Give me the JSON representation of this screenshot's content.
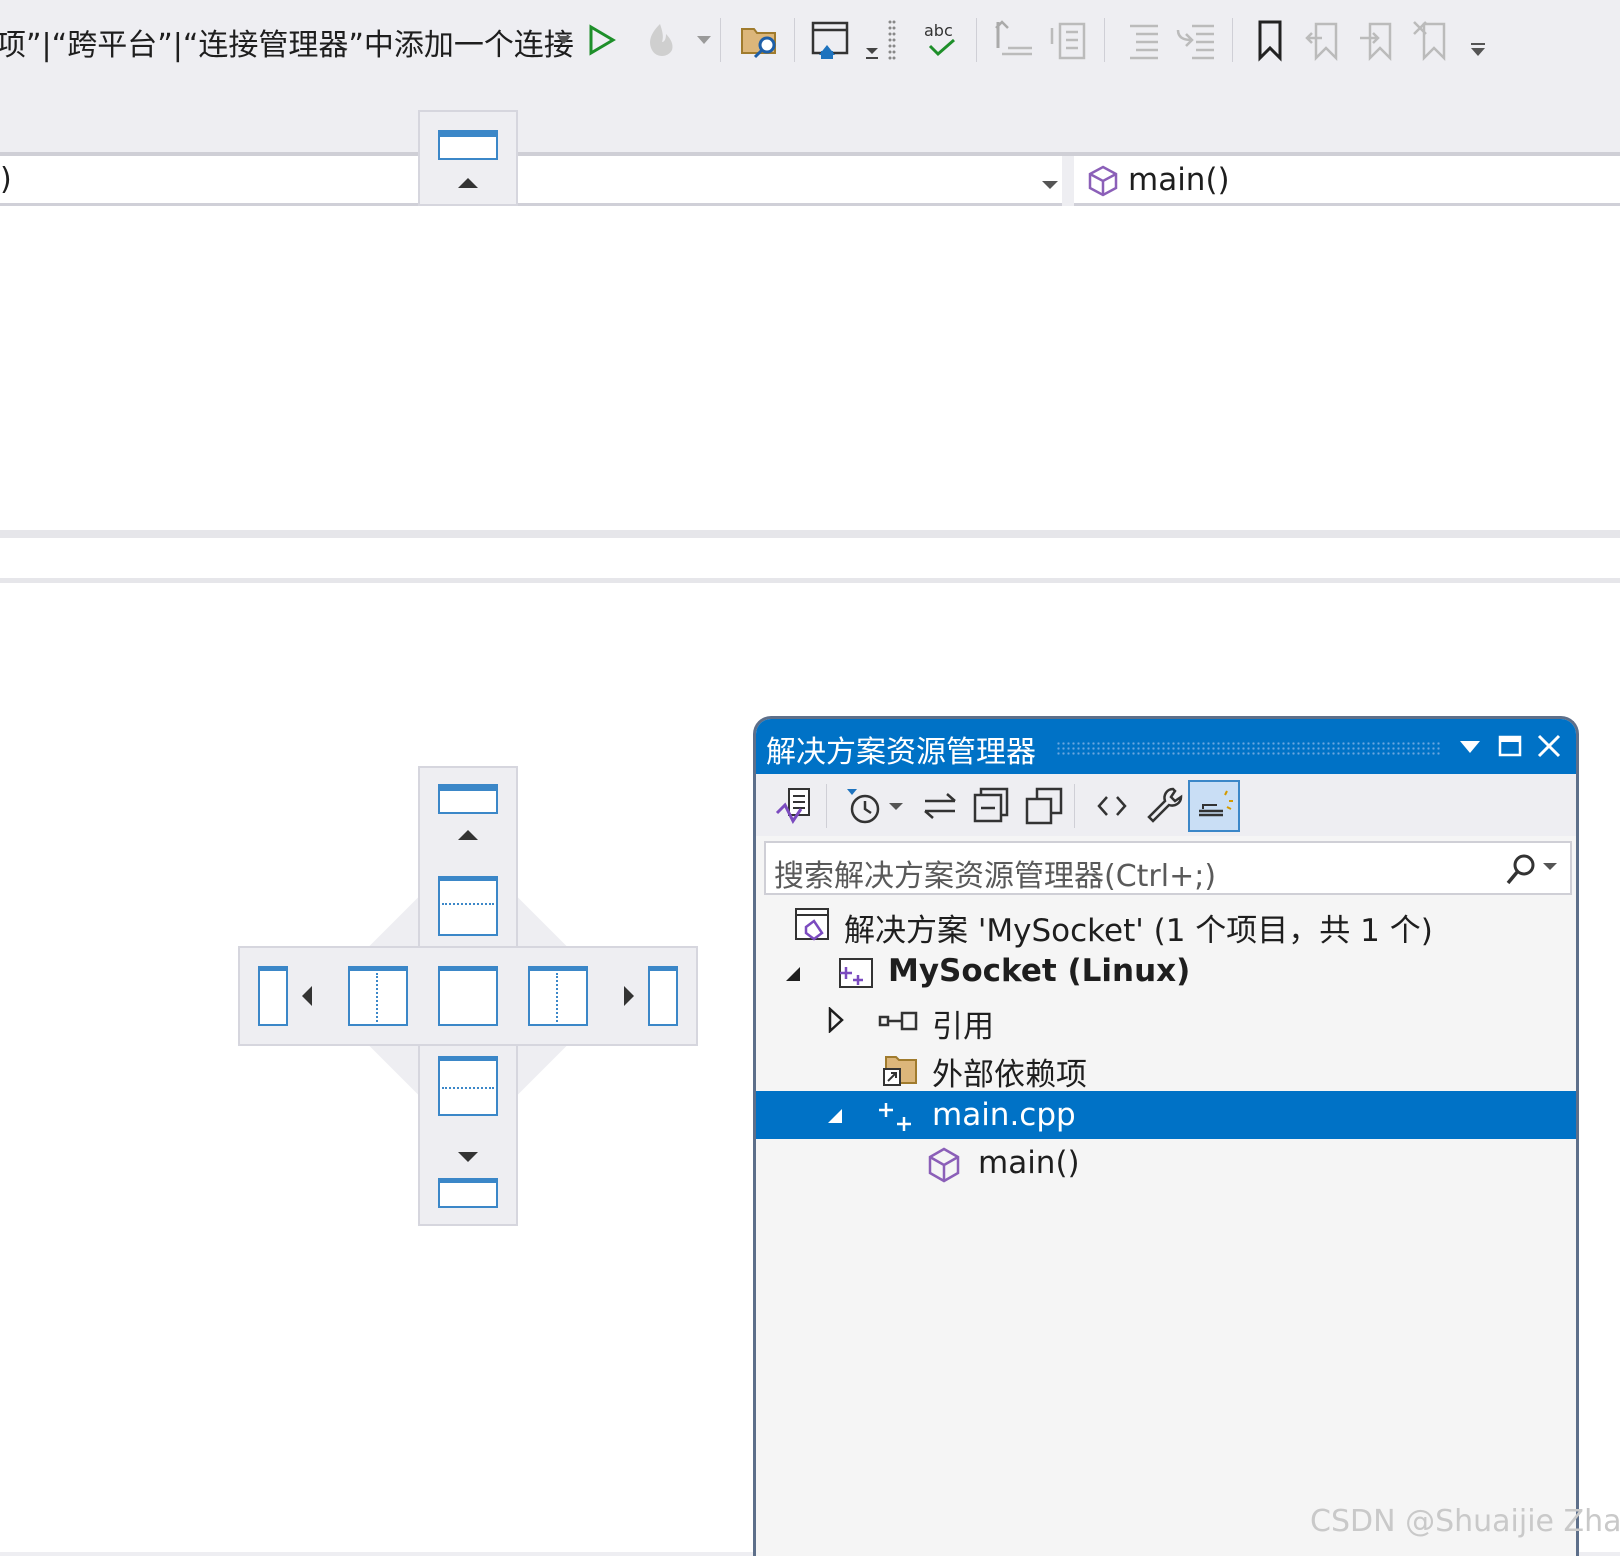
{
  "toolbar": {
    "label": "项”|“跨平台”|“连接管理器”中添加一个连接",
    "icons": [
      "dropdown-arrow-icon",
      "start-icon",
      "hot-reload-icon",
      "dropdown-arrow-icon",
      "find-in-files-icon",
      "home-window-icon",
      "overflow-icon",
      "spell-check-icon",
      "comment-icon",
      "uncomment-icon",
      "indent-icon",
      "outdent-icon",
      "bookmark-icon",
      "prev-bookmark-icon",
      "next-bookmark-icon",
      "clear-bookmarks-icon",
      "more-icon"
    ]
  },
  "navbar": {
    "left_text": ")",
    "right_text": "main()"
  },
  "solution_explorer": {
    "title": "解决方案资源管理器",
    "search_placeholder": "搜索解决方案资源管理器(Ctrl+;)",
    "tree": [
      {
        "label": "解决方案 'MySocket' (1 个项目，共 1 个)",
        "icon": "solution-icon",
        "expander": ""
      },
      {
        "label": "MySocket (Linux)",
        "icon": "cpp-project-icon",
        "expander": "expanded",
        "bold": true
      },
      {
        "label": "引用",
        "icon": "references-icon",
        "expander": "collapsed"
      },
      {
        "label": "外部依赖项",
        "icon": "external-deps-icon",
        "expander": ""
      },
      {
        "label": "main.cpp",
        "icon": "cpp-file-icon",
        "expander": "expanded",
        "selected": true
      },
      {
        "label": "main()",
        "icon": "method-icon",
        "expander": ""
      }
    ]
  },
  "watermark": "CSDN @Shuaijie Zhao",
  "colors": {
    "accent": "#0072c6",
    "dock_blue": "#3b87c8",
    "method_purple": "#8b5fb8"
  }
}
